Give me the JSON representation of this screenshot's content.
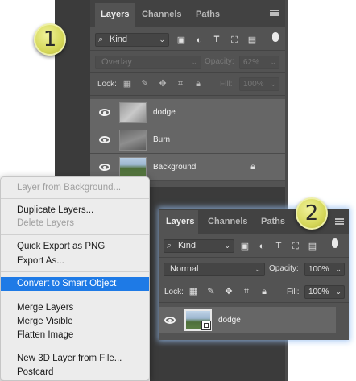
{
  "panel1": {
    "tabs": [
      "Layers",
      "Channels",
      "Paths"
    ],
    "active_tab": "Layers",
    "filter_kind": "Kind",
    "blend_mode": "Overlay",
    "opacity_label": "Opacity:",
    "opacity_value": "62%",
    "lock_label": "Lock:",
    "fill_label": "Fill:",
    "fill_value": "100%",
    "layers": [
      {
        "name": "dodge",
        "visible": true
      },
      {
        "name": "Burn",
        "visible": true
      },
      {
        "name": "Background",
        "visible": true,
        "locked": true
      }
    ]
  },
  "context_menu": {
    "items": [
      {
        "label": "Layer from Background...",
        "disabled": true
      },
      {
        "label": "Duplicate Layers...",
        "disabled": false
      },
      {
        "label": "Delete Layers",
        "disabled": true
      },
      {
        "label": "Quick Export as PNG",
        "disabled": false
      },
      {
        "label": "Export As...",
        "disabled": false
      },
      {
        "label": "Convert to Smart Object",
        "disabled": false,
        "highlighted": true
      },
      {
        "label": "Merge Layers",
        "disabled": false
      },
      {
        "label": "Merge Visible",
        "disabled": false
      },
      {
        "label": "Flatten Image",
        "disabled": false
      },
      {
        "label": "New 3D Layer from File...",
        "disabled": false
      },
      {
        "label": "Postcard",
        "disabled": false
      }
    ]
  },
  "panel2": {
    "tabs": [
      "Layers",
      "Channels",
      "Paths"
    ],
    "active_tab": "Layers",
    "filter_kind": "Kind",
    "blend_mode": "Normal",
    "opacity_label": "Opacity:",
    "opacity_value": "100%",
    "lock_label": "Lock:",
    "fill_label": "Fill:",
    "fill_value": "100%",
    "layers": [
      {
        "name": "dodge",
        "visible": true,
        "smart_object": true
      }
    ]
  },
  "badges": {
    "step1": "1",
    "step2": "2"
  },
  "colors": {
    "panel": "#535353",
    "highlight": "#1e7ae6",
    "badge": "#d6d85a"
  }
}
